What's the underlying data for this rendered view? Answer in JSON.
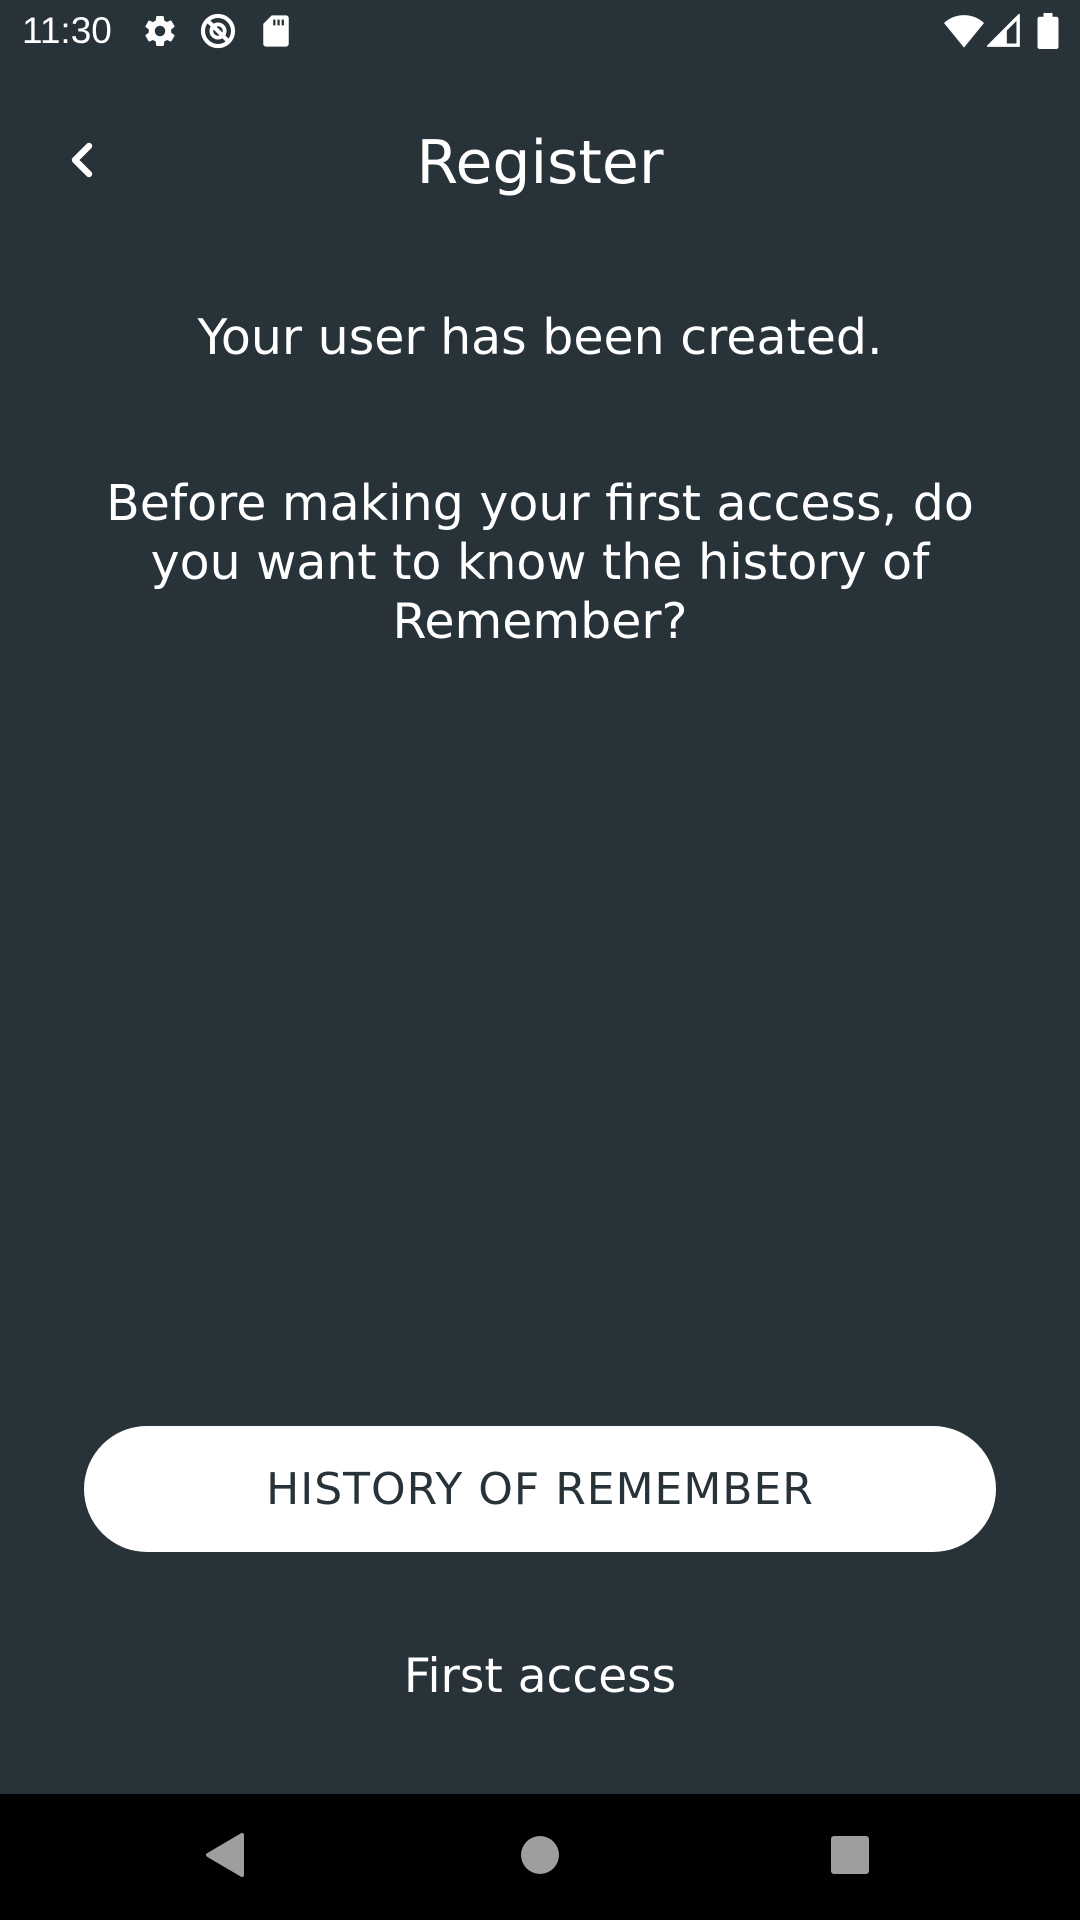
{
  "status_bar": {
    "time": "11:30",
    "left_icons": [
      "gear-icon",
      "no-sync-icon",
      "sd-card-icon"
    ],
    "right_icons": [
      "wifi-icon",
      "cell-signal-icon",
      "battery-icon"
    ]
  },
  "header": {
    "back_icon": "chevron-left-icon",
    "title": "Register"
  },
  "main": {
    "created_message": "Your user has been created.",
    "question": "Before making your first access, do you want to know the history of Remember?"
  },
  "actions": {
    "history_button_label": "HISTORY OF REMEMBER",
    "first_access_label": "First access"
  },
  "nav_bar": {
    "icons": [
      "back-triangle-icon",
      "home-circle-icon",
      "recents-square-icon"
    ]
  },
  "colors": {
    "background": "#283239",
    "text": "#ffffff",
    "button_bg": "#ffffff",
    "button_text": "#283239",
    "nav_bar": "#000000"
  }
}
